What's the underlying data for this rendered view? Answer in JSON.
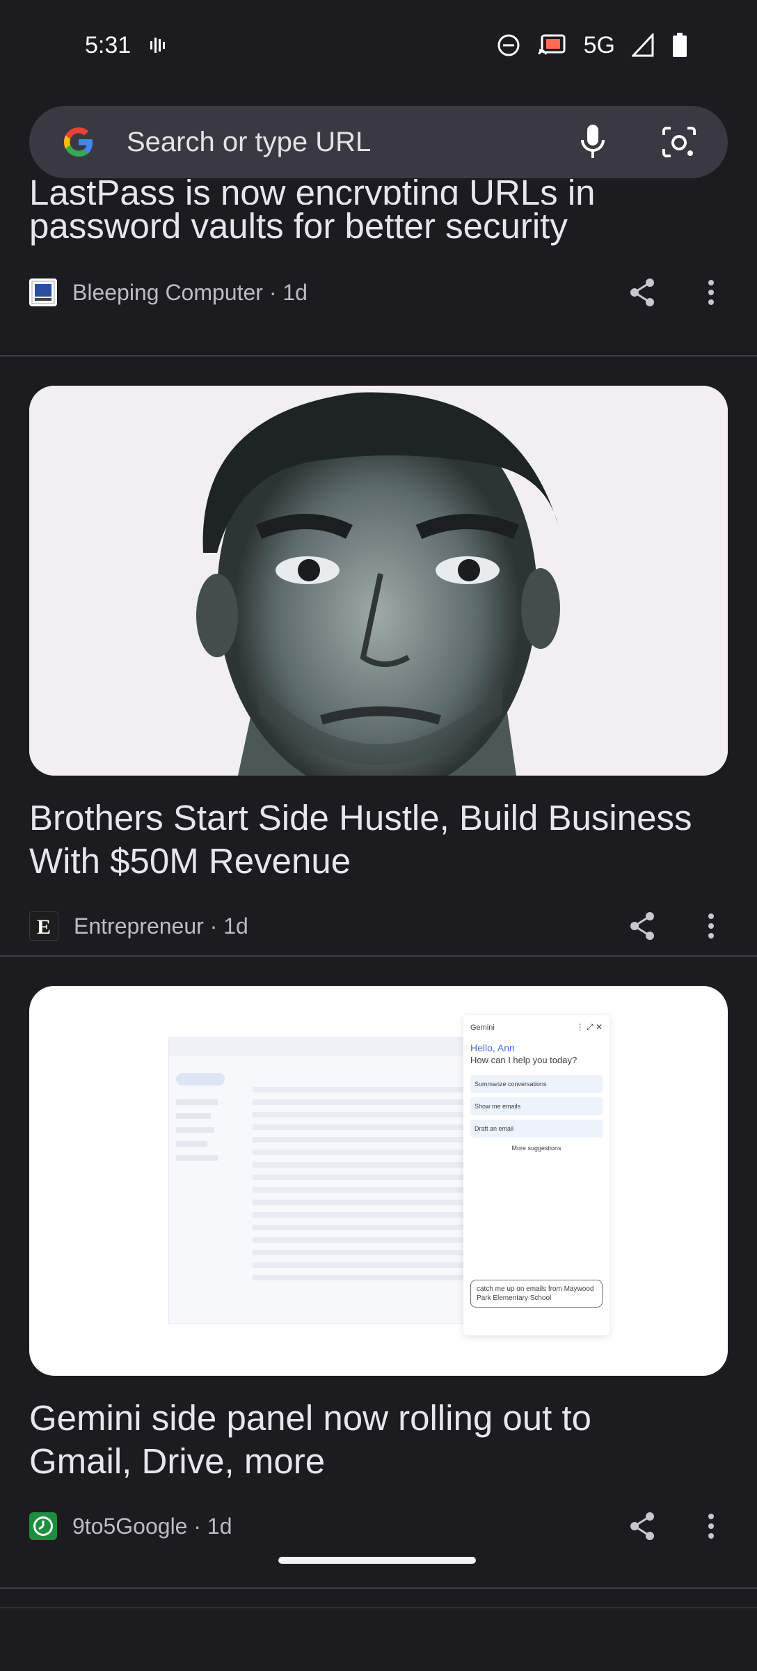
{
  "status": {
    "time": "5:31",
    "network": "5G"
  },
  "search": {
    "placeholder": "Search or type URL"
  },
  "feed": {
    "top_card": {
      "title_line1": "LastPass is now encrypting URLs in",
      "title_line2": "password vaults for better security",
      "publisher": "Bleeping Computer",
      "age": "1d"
    },
    "cards": [
      {
        "title_line1": "Brothers Start Side Hustle, Build Business",
        "title_line2": "With $50M Revenue",
        "publisher": "Entrepreneur",
        "age": "1d"
      },
      {
        "title_line1": "Gemini side panel now rolling out to",
        "title_line2": "Gmail, Drive, more",
        "publisher": "9to5Google",
        "age": "1d"
      }
    ]
  },
  "gemini_preview": {
    "panel_title": "Gemini",
    "greeting": "Hello, Ann",
    "prompt": "How can I help you today?",
    "suggestions": [
      "Summarize conversations",
      "Show me emails",
      "Draft an email"
    ],
    "more": "More suggestions",
    "input_text": "catch me up on emails from Maywood Park Elementary School"
  },
  "colors": {
    "background": "#1c1b20",
    "search_bg": "#3a3941",
    "divider": "#3f3e45"
  }
}
